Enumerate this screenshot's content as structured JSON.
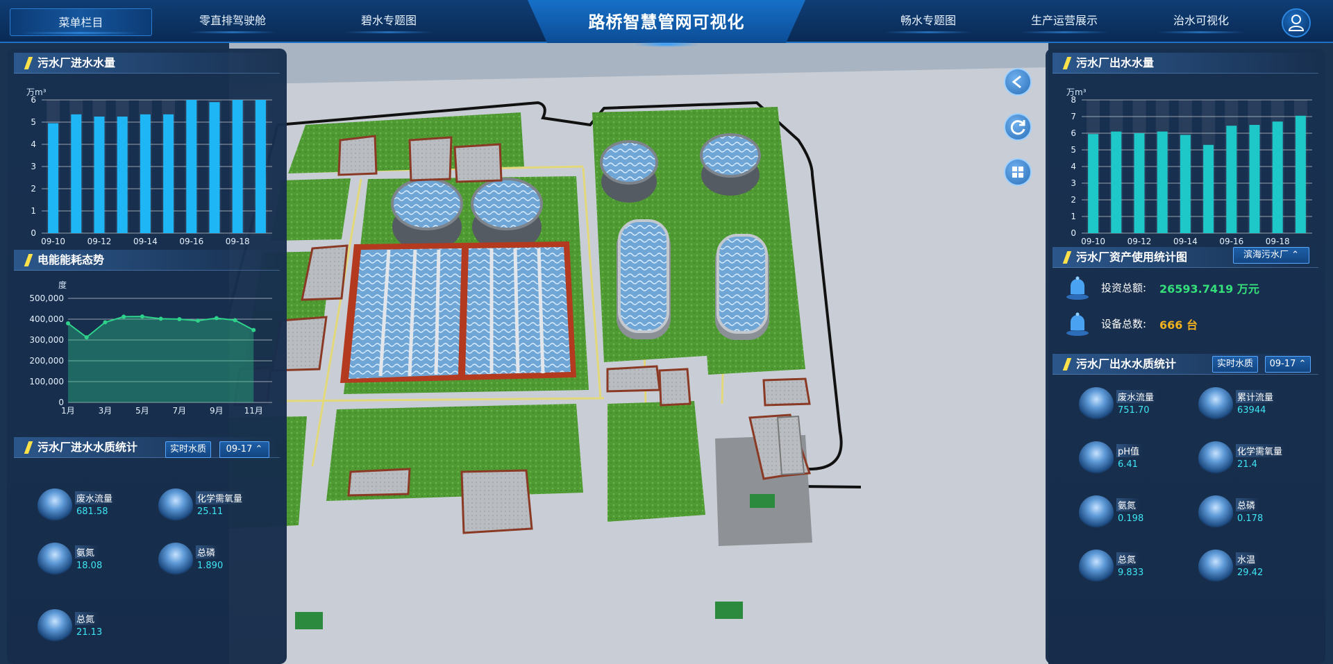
{
  "header": {
    "title": "路桥智慧管网可视化",
    "menu_label": "菜单栏目",
    "tabs_left": [
      "零直排驾驶舱",
      "碧水专题图"
    ],
    "tabs_right": [
      "畅水专题图",
      "生产运营展示",
      "治水可视化"
    ],
    "user_icon": "user-icon"
  },
  "left": {
    "inflow": {
      "title": "污水厂进水水量",
      "unit": "万m³",
      "chart_data": {
        "type": "bar",
        "categories": [
          "09-10",
          "09-11",
          "09-12",
          "09-13",
          "09-14",
          "09-15",
          "09-16",
          "09-17",
          "09-18",
          "09-19"
        ],
        "x_tick_labels": [
          "09-10",
          "09-12",
          "09-14",
          "09-16",
          "09-18"
        ],
        "values": [
          4.95,
          5.35,
          5.25,
          5.25,
          5.35,
          5.35,
          6.0,
          5.9,
          6.0,
          6.0
        ],
        "ylim": [
          0,
          6
        ],
        "y_ticks": [
          "0",
          "1",
          "2",
          "3",
          "4",
          "5",
          "6"
        ],
        "ylabel": "万m³",
        "color": "#1fb6f5"
      }
    },
    "energy": {
      "title": "电能能耗态势",
      "unit": "度",
      "chart_data": {
        "type": "area",
        "x": [
          "1月",
          "2月",
          "3月",
          "4月",
          "5月",
          "6月",
          "7月",
          "8月",
          "9月",
          "10月",
          "11月",
          "12月"
        ],
        "x_tick_labels": [
          "1月",
          "3月",
          "5月",
          "7月",
          "9月",
          "11月"
        ],
        "values": [
          380000,
          313000,
          385000,
          412000,
          413000,
          402000,
          400000,
          393000,
          405000,
          395000,
          348000
        ],
        "ylim": [
          0,
          500000
        ],
        "y_ticks": [
          "0",
          "100,000",
          "200,000",
          "300,000",
          "400,000",
          "500,000"
        ],
        "ylabel": "度",
        "color": "#2fd28a"
      }
    },
    "quality": {
      "title": "污水厂进水水质统计",
      "btn_realtime": "实时水质",
      "btn_date": "09-17",
      "metrics": [
        {
          "label": "废水流量",
          "value": "681.58"
        },
        {
          "label": "化学需氧量",
          "value": "25.11"
        },
        {
          "label": "氨氮",
          "value": "18.08"
        },
        {
          "label": "总磷",
          "value": "1.890"
        },
        {
          "label": "总氮",
          "value": "21.13"
        }
      ]
    }
  },
  "right": {
    "outflow": {
      "title": "污水厂出水水量",
      "unit": "万m³",
      "chart_data": {
        "type": "bar",
        "categories": [
          "09-10",
          "09-11",
          "09-12",
          "09-13",
          "09-14",
          "09-15",
          "09-16",
          "09-17",
          "09-18",
          "09-19"
        ],
        "x_tick_labels": [
          "09-10",
          "09-12",
          "09-14",
          "09-16",
          "09-18"
        ],
        "values": [
          5.95,
          6.1,
          6.0,
          6.1,
          5.9,
          5.3,
          6.45,
          6.5,
          6.7,
          7.05
        ],
        "ylim": [
          0,
          8
        ],
        "y_ticks": [
          "0",
          "1",
          "2",
          "3",
          "4",
          "5",
          "6",
          "7",
          "8"
        ],
        "ylabel": "万m³",
        "color": "#1ec8c8"
      }
    },
    "assets": {
      "title": "污水厂资产使用统计图",
      "plant_select": "滨海污水厂",
      "rows": [
        {
          "label": "投资总额:",
          "value": "26593.7419 万元",
          "color": "#35e07a"
        },
        {
          "label": "设备总数:",
          "value": "666 台",
          "color": "#f2b21e"
        }
      ]
    },
    "quality": {
      "title": "污水厂出水水质统计",
      "btn_realtime": "实时水质",
      "btn_date": "09-17",
      "metrics": [
        {
          "label": "废水流量",
          "value": "751.70"
        },
        {
          "label": "累计流量",
          "value": "63944"
        },
        {
          "label": "pH值",
          "value": "6.41"
        },
        {
          "label": "化学需氧量",
          "value": "21.4"
        },
        {
          "label": "氨氮",
          "value": "0.198"
        },
        {
          "label": "总磷",
          "value": "0.178"
        },
        {
          "label": "总氮",
          "value": "9.833"
        },
        {
          "label": "水温",
          "value": "29.42"
        }
      ]
    }
  },
  "map_controls": [
    "back-icon",
    "refresh-icon",
    "layers-icon"
  ]
}
